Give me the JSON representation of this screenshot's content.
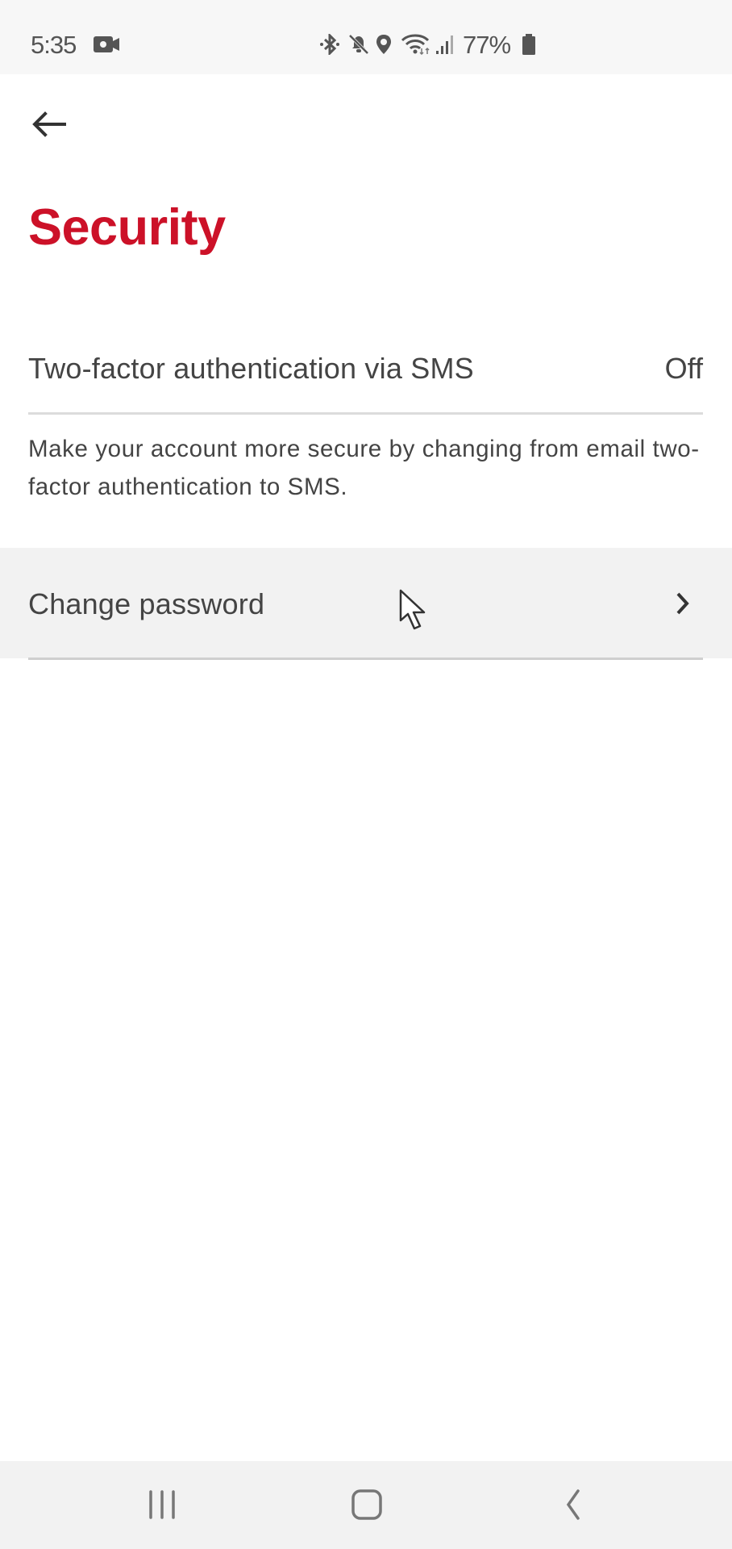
{
  "status_bar": {
    "time": "5:35",
    "battery_percent": "77%",
    "icons": [
      "video-camera-icon",
      "bluetooth-icon",
      "mute-icon",
      "location-icon",
      "wifi-icon",
      "signal-icon",
      "battery-icon"
    ]
  },
  "header": {
    "back_icon": "arrow-left-icon",
    "title": "Security"
  },
  "settings": {
    "two_factor": {
      "label": "Two-factor authentication via SMS",
      "value": "Off",
      "description": "Make your account more secure by changing from email two-factor authentication to SMS."
    },
    "change_password": {
      "label": "Change password",
      "icon": "chevron-right-icon"
    }
  },
  "nav_bar": {
    "buttons": [
      "recent-apps-icon",
      "home-icon",
      "back-icon"
    ]
  },
  "colors": {
    "accent": "#cc1128",
    "text": "#444444",
    "row_highlight": "#f2f2f2"
  }
}
